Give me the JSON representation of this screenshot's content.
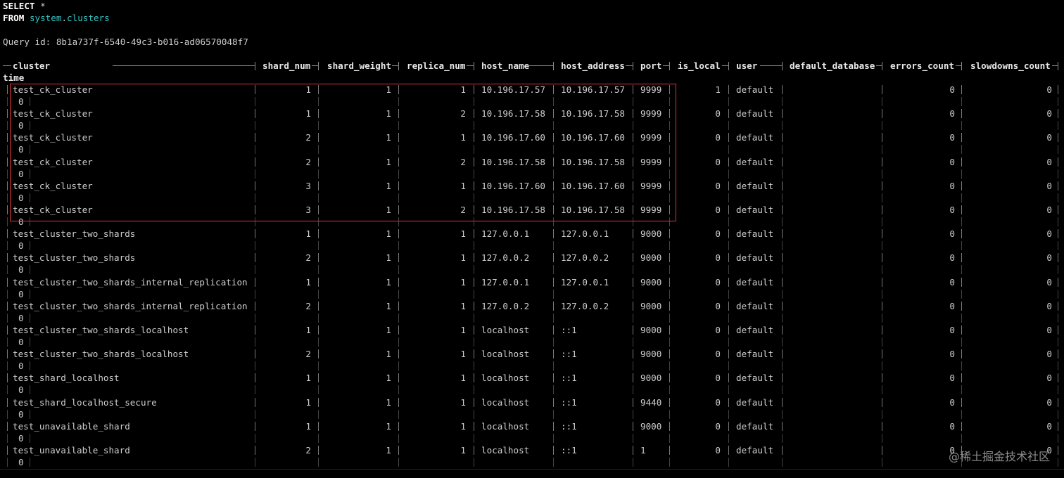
{
  "query": {
    "line1_kw": "SELECT",
    "line1_rest": " *",
    "line2_kw": "FROM",
    "line2_db": "system",
    "line2_dot": ".",
    "line2_table": "clusters",
    "query_id": "Query id: 8b1a737f-6540-49c3-b016-ad06570048f7"
  },
  "table": {
    "columns": [
      "cluster",
      "shard_num",
      "shard_weight",
      "replica_num",
      "host_name",
      "host_address",
      "port",
      "is_local",
      "user",
      "default_database",
      "errors_count",
      "slowdowns_count"
    ],
    "wrapped_column": "time",
    "rows": [
      {
        "cluster": "test_ck_cluster",
        "shard_num": "1",
        "shard_weight": "1",
        "replica_num": "1",
        "host_name": "10.196.17.57",
        "host_address": "10.196.17.57",
        "port": "9999",
        "is_local": "1",
        "user": "default",
        "default_database": "",
        "errors_count": "0",
        "slowdowns_count": "0",
        "time": "0"
      },
      {
        "cluster": "test_ck_cluster",
        "shard_num": "1",
        "shard_weight": "1",
        "replica_num": "2",
        "host_name": "10.196.17.58",
        "host_address": "10.196.17.58",
        "port": "9999",
        "is_local": "0",
        "user": "default",
        "default_database": "",
        "errors_count": "0",
        "slowdowns_count": "0",
        "time": "0"
      },
      {
        "cluster": "test_ck_cluster",
        "shard_num": "2",
        "shard_weight": "1",
        "replica_num": "1",
        "host_name": "10.196.17.60",
        "host_address": "10.196.17.60",
        "port": "9999",
        "is_local": "0",
        "user": "default",
        "default_database": "",
        "errors_count": "0",
        "slowdowns_count": "0",
        "time": "0"
      },
      {
        "cluster": "test_ck_cluster",
        "shard_num": "2",
        "shard_weight": "1",
        "replica_num": "2",
        "host_name": "10.196.17.58",
        "host_address": "10.196.17.58",
        "port": "9999",
        "is_local": "0",
        "user": "default",
        "default_database": "",
        "errors_count": "0",
        "slowdowns_count": "0",
        "time": "0"
      },
      {
        "cluster": "test_ck_cluster",
        "shard_num": "3",
        "shard_weight": "1",
        "replica_num": "1",
        "host_name": "10.196.17.60",
        "host_address": "10.196.17.60",
        "port": "9999",
        "is_local": "0",
        "user": "default",
        "default_database": "",
        "errors_count": "0",
        "slowdowns_count": "0",
        "time": "0"
      },
      {
        "cluster": "test_ck_cluster",
        "shard_num": "3",
        "shard_weight": "1",
        "replica_num": "2",
        "host_name": "10.196.17.58",
        "host_address": "10.196.17.58",
        "port": "9999",
        "is_local": "0",
        "user": "default",
        "default_database": "",
        "errors_count": "0",
        "slowdowns_count": "0",
        "time": "0"
      },
      {
        "cluster": "test_cluster_two_shards",
        "shard_num": "1",
        "shard_weight": "1",
        "replica_num": "1",
        "host_name": "127.0.0.1",
        "host_address": "127.0.0.1",
        "port": "9000",
        "is_local": "0",
        "user": "default",
        "default_database": "",
        "errors_count": "0",
        "slowdowns_count": "0",
        "time": "0"
      },
      {
        "cluster": "test_cluster_two_shards",
        "shard_num": "2",
        "shard_weight": "1",
        "replica_num": "1",
        "host_name": "127.0.0.2",
        "host_address": "127.0.0.2",
        "port": "9000",
        "is_local": "0",
        "user": "default",
        "default_database": "",
        "errors_count": "0",
        "slowdowns_count": "0",
        "time": "0"
      },
      {
        "cluster": "test_cluster_two_shards_internal_replication",
        "shard_num": "1",
        "shard_weight": "1",
        "replica_num": "1",
        "host_name": "127.0.0.1",
        "host_address": "127.0.0.1",
        "port": "9000",
        "is_local": "0",
        "user": "default",
        "default_database": "",
        "errors_count": "0",
        "slowdowns_count": "0",
        "time": "0"
      },
      {
        "cluster": "test_cluster_two_shards_internal_replication",
        "shard_num": "2",
        "shard_weight": "1",
        "replica_num": "1",
        "host_name": "127.0.0.2",
        "host_address": "127.0.0.2",
        "port": "9000",
        "is_local": "0",
        "user": "default",
        "default_database": "",
        "errors_count": "0",
        "slowdowns_count": "0",
        "time": "0"
      },
      {
        "cluster": "test_cluster_two_shards_localhost",
        "shard_num": "1",
        "shard_weight": "1",
        "replica_num": "1",
        "host_name": "localhost",
        "host_address": "::1",
        "port": "9000",
        "is_local": "0",
        "user": "default",
        "default_database": "",
        "errors_count": "0",
        "slowdowns_count": "0",
        "time": "0"
      },
      {
        "cluster": "test_cluster_two_shards_localhost",
        "shard_num": "2",
        "shard_weight": "1",
        "replica_num": "1",
        "host_name": "localhost",
        "host_address": "::1",
        "port": "9000",
        "is_local": "0",
        "user": "default",
        "default_database": "",
        "errors_count": "0",
        "slowdowns_count": "0",
        "time": "0"
      },
      {
        "cluster": "test_shard_localhost",
        "shard_num": "1",
        "shard_weight": "1",
        "replica_num": "1",
        "host_name": "localhost",
        "host_address": "::1",
        "port": "9000",
        "is_local": "0",
        "user": "default",
        "default_database": "",
        "errors_count": "0",
        "slowdowns_count": "0",
        "time": "0"
      },
      {
        "cluster": "test_shard_localhost_secure",
        "shard_num": "1",
        "shard_weight": "1",
        "replica_num": "1",
        "host_name": "localhost",
        "host_address": "::1",
        "port": "9440",
        "is_local": "0",
        "user": "default",
        "default_database": "",
        "errors_count": "0",
        "slowdowns_count": "0",
        "time": "0"
      },
      {
        "cluster": "test_unavailable_shard",
        "shard_num": "1",
        "shard_weight": "1",
        "replica_num": "1",
        "host_name": "localhost",
        "host_address": "::1",
        "port": "9000",
        "is_local": "0",
        "user": "default",
        "default_database": "",
        "errors_count": "0",
        "slowdowns_count": "0",
        "time": "0"
      },
      {
        "cluster": "test_unavailable_shard",
        "shard_num": "2",
        "shard_weight": "1",
        "replica_num": "1",
        "host_name": "localhost",
        "host_address": "::1",
        "port": "1",
        "is_local": "0",
        "user": "default",
        "default_database": "",
        "errors_count": "0",
        "slowdowns_count": "0",
        "time": "0"
      }
    ]
  },
  "watermark": "@稀土掘金技术社区",
  "colors": {
    "background": "#000000",
    "text": "#cfcfcf",
    "identifier": "#33c6c6",
    "highlight_box": "#e0353b"
  }
}
